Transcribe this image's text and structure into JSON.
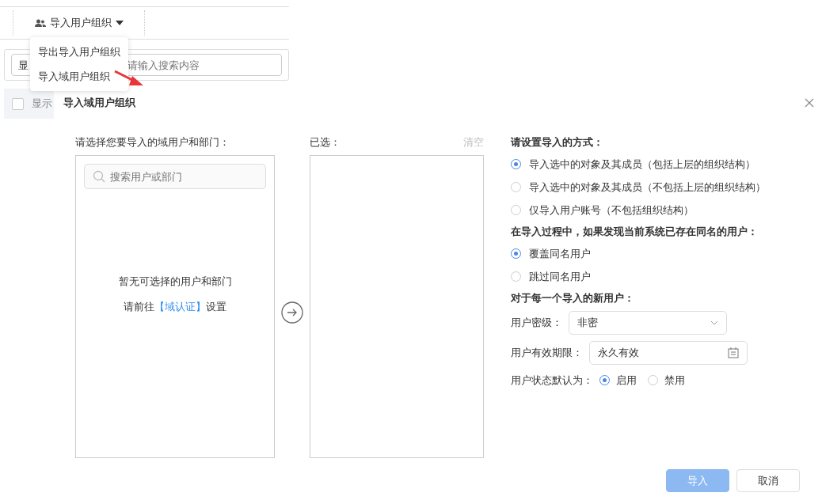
{
  "toolbar": {
    "button": "导入用户组织"
  },
  "menu": {
    "items": [
      "导出导入用户组织",
      "导入域用户组织"
    ]
  },
  "filter": {
    "select_value": "显",
    "search_placeholder": "请输入搜索内容"
  },
  "list_header": {
    "checked": false,
    "label": "显示"
  },
  "dialog": {
    "title": "导入域用户组织",
    "source": {
      "label": "请选择您要导入的域用户和部门：",
      "search_placeholder": "搜索用户或部门",
      "empty_text": "暂无可选择的用户和部门",
      "hint_prefix": "请前往",
      "hint_link": "【域认证】",
      "hint_suffix": "设置"
    },
    "target": {
      "label": "已选：",
      "clear": "清空"
    },
    "import_mode": {
      "heading": "请设置导入的方式：",
      "options": [
        {
          "label": "导入选中的对象及其成员（包括上层的组织结构）",
          "selected": true
        },
        {
          "label": "导入选中的对象及其成员（不包括上层的组织结构）",
          "selected": false
        },
        {
          "label": "仅导入用户账号（不包括组织结构）",
          "selected": false
        }
      ]
    },
    "duplicate": {
      "heading": "在导入过程中，如果发现当前系统已存在同名的用户：",
      "options": [
        {
          "label": "覆盖同名用户",
          "selected": true
        },
        {
          "label": "跳过同名用户",
          "selected": false
        }
      ]
    },
    "new_user": {
      "heading": "对于每一个导入的新用户：",
      "level": {
        "label": "用户密级：",
        "value": "非密"
      },
      "expiry": {
        "label": "用户有效期限：",
        "value": "永久有效"
      },
      "status": {
        "label": "用户状态默认为：",
        "options": [
          {
            "label": "启用",
            "selected": true
          },
          {
            "label": "禁用",
            "selected": false
          }
        ]
      }
    },
    "buttons": [
      {
        "label": "导入",
        "kind": "primary",
        "disabled": true
      },
      {
        "label": "取消",
        "kind": "default",
        "disabled": false
      }
    ]
  }
}
